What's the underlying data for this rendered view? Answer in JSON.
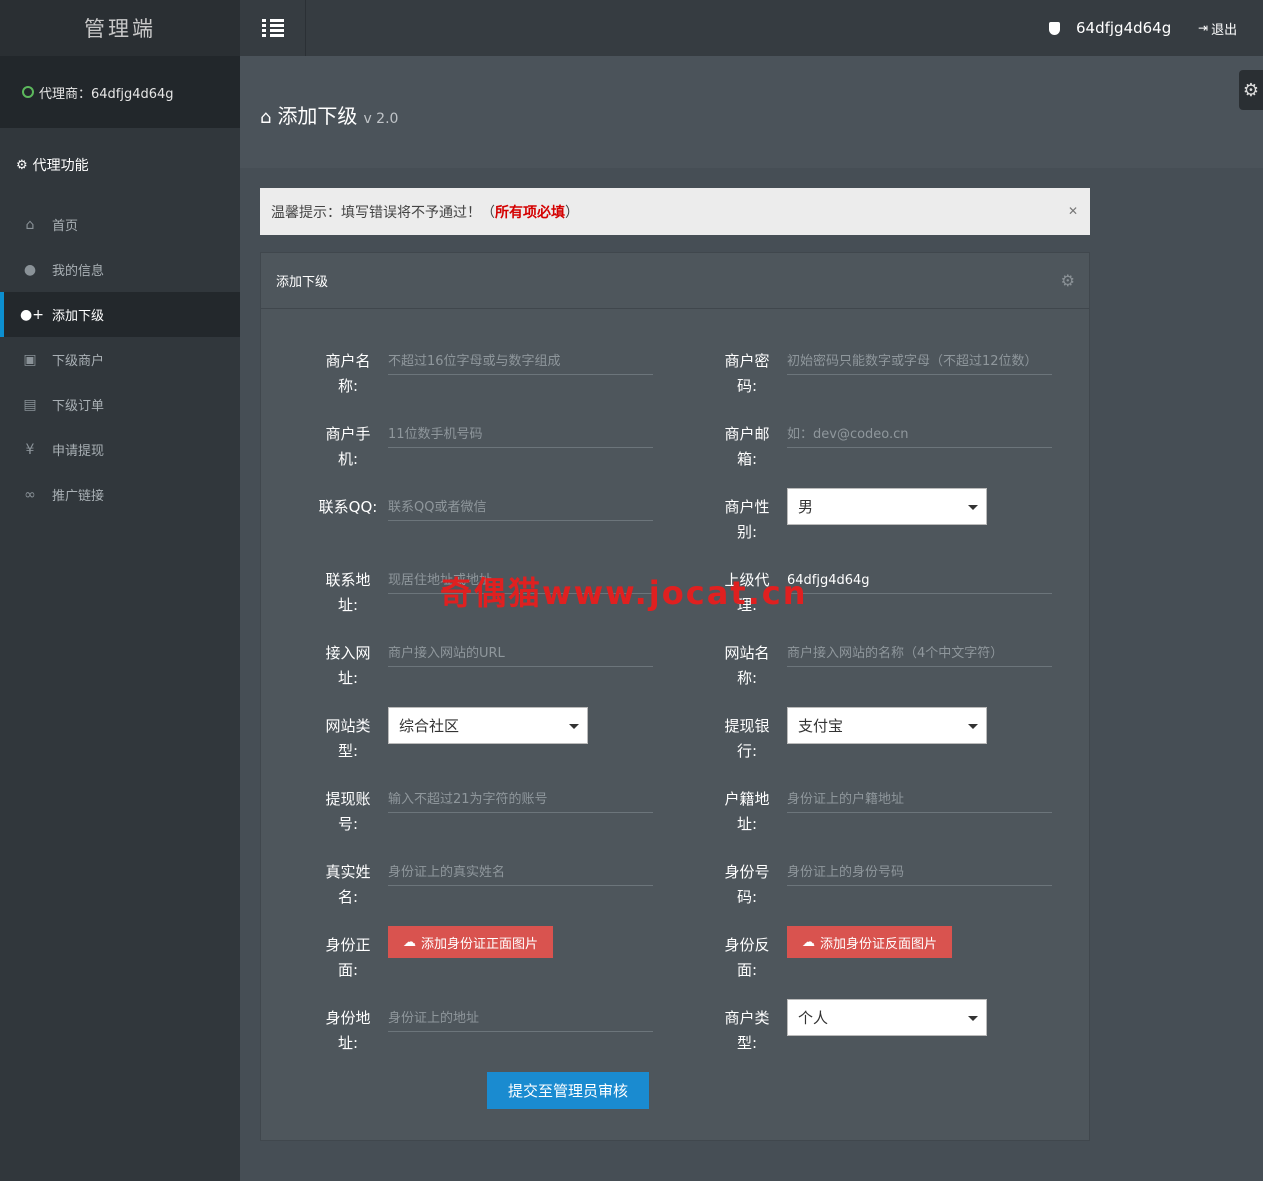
{
  "brand": "管理端",
  "agent_label": "代理商：64dfjg4d64g",
  "section_title": "代理功能",
  "nav": [
    {
      "label": "首页",
      "icon": "home-icon"
    },
    {
      "label": "我的信息",
      "icon": "user-icon"
    },
    {
      "label": "添加下级",
      "icon": "user-add-icon"
    },
    {
      "label": "下级商户",
      "icon": "merchant-icon"
    },
    {
      "label": "下级订单",
      "icon": "document-icon"
    },
    {
      "label": "申请提现",
      "icon": "yen-icon"
    },
    {
      "label": "推广链接",
      "icon": "link-icon"
    }
  ],
  "topbar": {
    "username": "64dfjg4d64g",
    "logout": "退出"
  },
  "page": {
    "title": "添加下级",
    "version": "v 2.0"
  },
  "alert": {
    "prefix": "温馨提示：填写错误将不予通过！（",
    "required": "所有项必填",
    "suffix": "）"
  },
  "panel": {
    "title": "添加下级"
  },
  "form": {
    "merchant_name": {
      "label": "商户名称:",
      "placeholder": "不超过16位字母或与数字组成"
    },
    "merchant_password": {
      "label": "商户密码:",
      "placeholder": "初始密码只能数字或字母（不超过12位数）"
    },
    "merchant_phone": {
      "label": "商户手机:",
      "placeholder": "11位数手机号码"
    },
    "merchant_email": {
      "label": "商户邮箱:",
      "placeholder": "如：dev@codeo.cn"
    },
    "contact_qq": {
      "label": "联系QQ:",
      "placeholder": "联系QQ或者微信"
    },
    "merchant_gender": {
      "label": "商户性别:",
      "value": "男"
    },
    "contact_address": {
      "label": "联系地址:",
      "placeholder": "现居住地址或地址"
    },
    "parent_agent": {
      "label": "上级代理:",
      "value": "64dfjg4d64g"
    },
    "site_url": {
      "label": "接入网址:",
      "placeholder": "商户接入网站的URL"
    },
    "site_name": {
      "label": "网站名称:",
      "placeholder": "商户接入网站的名称（4个中文字符）"
    },
    "site_type": {
      "label": "网站类型:",
      "value": "综合社区"
    },
    "withdraw_bank": {
      "label": "提现银行:",
      "value": "支付宝"
    },
    "withdraw_account": {
      "label": "提现账号:",
      "placeholder": "输入不超过21为字符的账号"
    },
    "household_address": {
      "label": "户籍地址:",
      "placeholder": "身份证上的户籍地址"
    },
    "real_name": {
      "label": "真实姓名:",
      "placeholder": "身份证上的真实姓名"
    },
    "id_number": {
      "label": "身份号码:",
      "placeholder": "身份证上的身份号码"
    },
    "id_front": {
      "label": "身份正面:",
      "button": "添加身份证正面图片"
    },
    "id_back": {
      "label": "身份反面:",
      "button": "添加身份证反面图片"
    },
    "id_address": {
      "label": "身份地址:",
      "placeholder": "身份证上的地址"
    },
    "merchant_type": {
      "label": "商户类型:",
      "value": "个人"
    },
    "submit": "提交至管理员审核"
  },
  "watermark": "奇偶猫www.jocat.cn"
}
